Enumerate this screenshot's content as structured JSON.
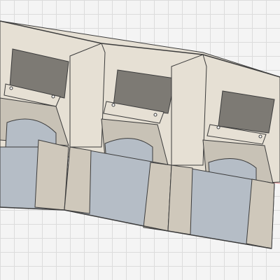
{
  "viewport": {
    "grid": true,
    "colors": {
      "background": "#f4f4f4",
      "grid_line": "#dcdcdc",
      "axis_red": "#e88a8a",
      "body": "#e4ded2",
      "body_dark": "#cfc8bb",
      "inner_shade": "#b9b3a8",
      "floor": "#b5bdc6",
      "opening": "#7d7a74",
      "edge": "#3c3c3c"
    }
  },
  "model": {
    "type": "3d-cad-model",
    "units": 3,
    "description_icon": "three-bay-holder"
  }
}
